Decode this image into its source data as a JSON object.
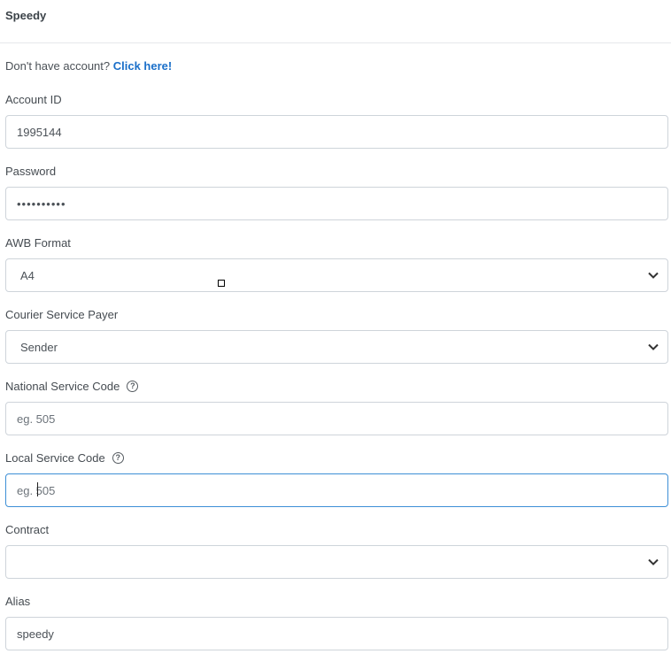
{
  "panel": {
    "title": "Speedy"
  },
  "signup": {
    "prompt": "Don't have account? ",
    "link_label": "Click here!"
  },
  "fields": {
    "account_id": {
      "label": "Account ID",
      "value": "1995144"
    },
    "password": {
      "label": "Password",
      "value": "••••••••••"
    },
    "awb_format": {
      "label": "AWB Format",
      "selected": "A4"
    },
    "courier_payer": {
      "label": "Courier Service Payer",
      "selected": "Sender"
    },
    "national_code": {
      "label": "National Service Code",
      "placeholder": "eg. 505"
    },
    "local_code": {
      "label": "Local Service Code",
      "placeholder": "eg. 505"
    },
    "contract": {
      "label": "Contract",
      "selected": ""
    },
    "alias": {
      "label": "Alias",
      "value": "speedy"
    }
  },
  "icons": {
    "help": "question-circle-icon",
    "dropdown": "chevron-down-icon"
  },
  "colors": {
    "link": "#1a6fc9",
    "focus_border": "#3d8fd6",
    "border": "#ced4da"
  }
}
